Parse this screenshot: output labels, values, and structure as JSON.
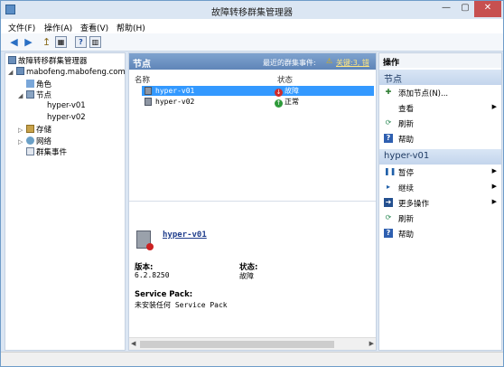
{
  "window": {
    "title": "故障转移群集管理器",
    "min": "—",
    "max": "▢",
    "close": "✕"
  },
  "menu": [
    "文件(F)",
    "操作(A)",
    "查看(V)",
    "帮助(H)"
  ],
  "toolbar": {
    "back": "◀",
    "forward": "▶",
    "up": "↥",
    "grid": "▦",
    "help": "?",
    "panel": "▥"
  },
  "tree": {
    "root": "故障转移群集管理器",
    "cluster": "mabofeng.mabofeng.com",
    "roles": "角色",
    "nodes": "节点",
    "node1": "hyper-v01",
    "node2": "hyper-v02",
    "storage": "存储",
    "network": "网络",
    "events": "群集事件"
  },
  "center": {
    "header": "节点",
    "recent_events_label": "最近的群集事件:",
    "recent_events_link": "关键:3, 错",
    "col_name": "名称",
    "col_status": "状态",
    "rows": [
      {
        "name": "hyper-v01",
        "status": "故障"
      },
      {
        "name": "hyper-v02",
        "status": "正常"
      }
    ],
    "detail": {
      "name": "hyper-v01",
      "version_label": "版本:",
      "version": "6.2.8250",
      "status_label": "状态:",
      "status": "故障",
      "sp_label": "Service Pack:",
      "sp_value": "未安装任何 Service Pack"
    }
  },
  "actions": {
    "title": "操作",
    "section1": "节点",
    "items1": [
      {
        "icon": "add-node-icon",
        "label": "添加节点(N)...",
        "submenu": false
      },
      {
        "icon": "view-icon",
        "label": "查看",
        "submenu": true
      },
      {
        "icon": "refresh-icon",
        "label": "刷新",
        "submenu": false
      },
      {
        "icon": "help-icon",
        "label": "帮助",
        "submenu": false
      }
    ],
    "section2": "hyper-v01",
    "items2": [
      {
        "icon": "pause-icon",
        "label": "暂停",
        "submenu": true
      },
      {
        "icon": "resume-icon",
        "label": "继续",
        "submenu": true
      },
      {
        "icon": "more-actions-icon",
        "label": "更多操作",
        "submenu": true
      },
      {
        "icon": "refresh-icon",
        "label": "刷新",
        "submenu": false
      },
      {
        "icon": "help-icon",
        "label": "帮助",
        "submenu": false
      }
    ]
  },
  "colors": {
    "accent": "#3399ff",
    "error": "#d12b2b",
    "ok": "#2e9a3a",
    "header": "#6a8fc2"
  }
}
